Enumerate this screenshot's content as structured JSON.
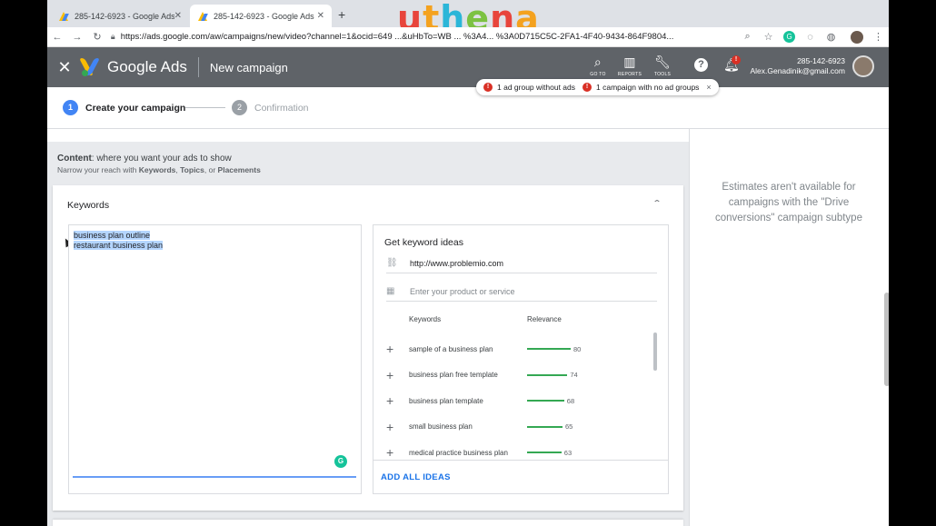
{
  "browser": {
    "tabs": [
      {
        "title": "285-142-6923 - Google Ads"
      },
      {
        "title": "285-142-6923 - Google Ads"
      }
    ],
    "new_tab_label": "+",
    "url": "https://ads.google.com/aw/campaigns/new/video?channel=1&ocid=649 ...&uHbTo=WB ... %3A4... %3A0D715C5C-2FA1-4F40-9434-864F9804...",
    "watermark": "uthena",
    "watermark_colors": [
      "#e8453c",
      "#f4a21f",
      "#2bb6d8",
      "#7cc242",
      "#e8453c",
      "#f4a21f"
    ]
  },
  "header": {
    "brand": "Google Ads",
    "page": "New campaign",
    "tools": [
      {
        "label": "GO TO",
        "icon": "search-icon"
      },
      {
        "label": "REPORTS",
        "icon": "bar-chart-icon"
      },
      {
        "label": "TOOLS",
        "icon": "wrench-icon"
      }
    ],
    "help": "?",
    "bell_badge": "!",
    "account_id": "285-142-6923",
    "account_email": "Alex.Genadinik@gmail.com"
  },
  "alerts": {
    "items": [
      "1 ad group without ads",
      "1 campaign with no ad groups"
    ],
    "icon": "!",
    "close": "×"
  },
  "stepper": {
    "steps": [
      {
        "num": "1",
        "label": "Create your campaign"
      },
      {
        "num": "2",
        "label": "Confirmation"
      }
    ]
  },
  "content": {
    "heading_bold": "Content",
    "heading_rest": ": where you want your ads to show",
    "sub_prefix": "Narrow your reach with ",
    "sub_kw": "Keywords",
    "sub_sep1": ", ",
    "sub_topics": "Topics",
    "sub_sep2": ", or ",
    "sub_placements": "Placements"
  },
  "keywords": {
    "title": "Keywords",
    "entered": [
      "business plan outline",
      "restaurant business plan"
    ]
  },
  "ideas": {
    "title": "Get keyword ideas",
    "url_value": "http://www.problemio.com",
    "product_placeholder": "Enter your product or service",
    "col_keywords": "Keywords",
    "col_relevance": "Relevance",
    "items": [
      {
        "keyword": "sample of a business plan",
        "relevance": 80
      },
      {
        "keyword": "business plan free template",
        "relevance": 74
      },
      {
        "keyword": "business plan template",
        "relevance": 68
      },
      {
        "keyword": "small business plan",
        "relevance": 65
      },
      {
        "keyword": "medical practice business plan",
        "relevance": 63
      }
    ],
    "add_all": "ADD ALL IDEAS"
  },
  "estimates": {
    "message": "Estimates aren't available for campaigns with the \"Drive conversions\" campaign subtype"
  }
}
